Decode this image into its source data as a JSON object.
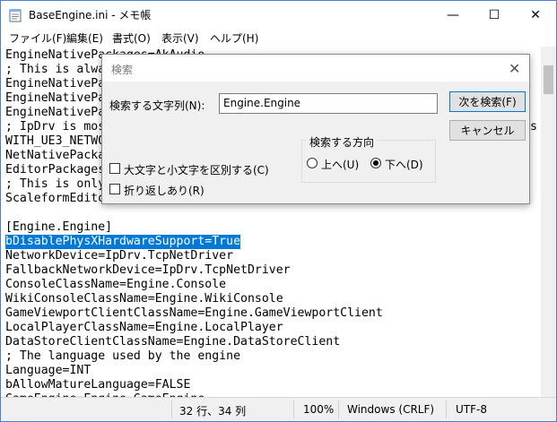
{
  "window": {
    "title": "BaseEngine.ini - メモ帳",
    "minimize_glyph": "—",
    "maximize_glyph": "☐",
    "close_glyph": "✕"
  },
  "menu": [
    {
      "label": "ファイル(F)"
    },
    {
      "label": "編集(E)"
    },
    {
      "label": "書式(O)"
    },
    {
      "label": "表示(V)"
    },
    {
      "label": "ヘルプ(H)"
    }
  ],
  "editor": {
    "lines": [
      "EngineNativePackages=AkAudio",
      "; This is always loaded",
      "EngineNativePackages=",
      "EngineNativePackages=",
      "EngineNativePackages=",
      "; IpDrv is mostly loaded",
      "WITH_UE3_NETWORK",
      "NetNativePackages=IpDrv",
      "EditorPackages=",
      "; This is only loaded",
      "ScaleformEditor",
      "",
      "[Engine.Engine]",
      "bDisablePhysXHardwareSupport=True",
      "NetworkDevice=IpDrv.TcpNetDriver",
      "FallbackNetworkDevice=IpDrv.TcpNetDriver",
      "ConsoleClassName=Engine.Console",
      "WikiConsoleClassName=Engine.WikiConsole",
      "GameViewportClientClassName=Engine.GameViewportClient",
      "LocalPlayerClassName=Engine.LocalPlayer",
      "DataStoreClientClassName=Engine.DataStoreClient",
      "; The language used by the engine",
      "Language=INT",
      "bAllowMatureLanguage=FALSE",
      "GameEngine=Engine.GameEngine"
    ],
    "selected_line_index": 13,
    "right_edge_char": "s"
  },
  "find_dialog": {
    "title": "検索",
    "close_glyph": "✕",
    "search_label": "検索する文字列(N):",
    "search_value": "Engine.Engine",
    "find_next_label": "次を検索(F)",
    "cancel_label": "キャンセル",
    "direction_label": "検索する方向",
    "up_label": "上へ(U)",
    "down_label": "下へ(D)",
    "match_case_label": "大文字と小文字を区別する(C)",
    "wrap_label": "折り返しあり(R)",
    "direction_selected": "down"
  },
  "status": {
    "position": "32 行、34 列",
    "zoom": "100%",
    "line_ending": "Windows (CRLF)",
    "encoding": "UTF-8"
  }
}
